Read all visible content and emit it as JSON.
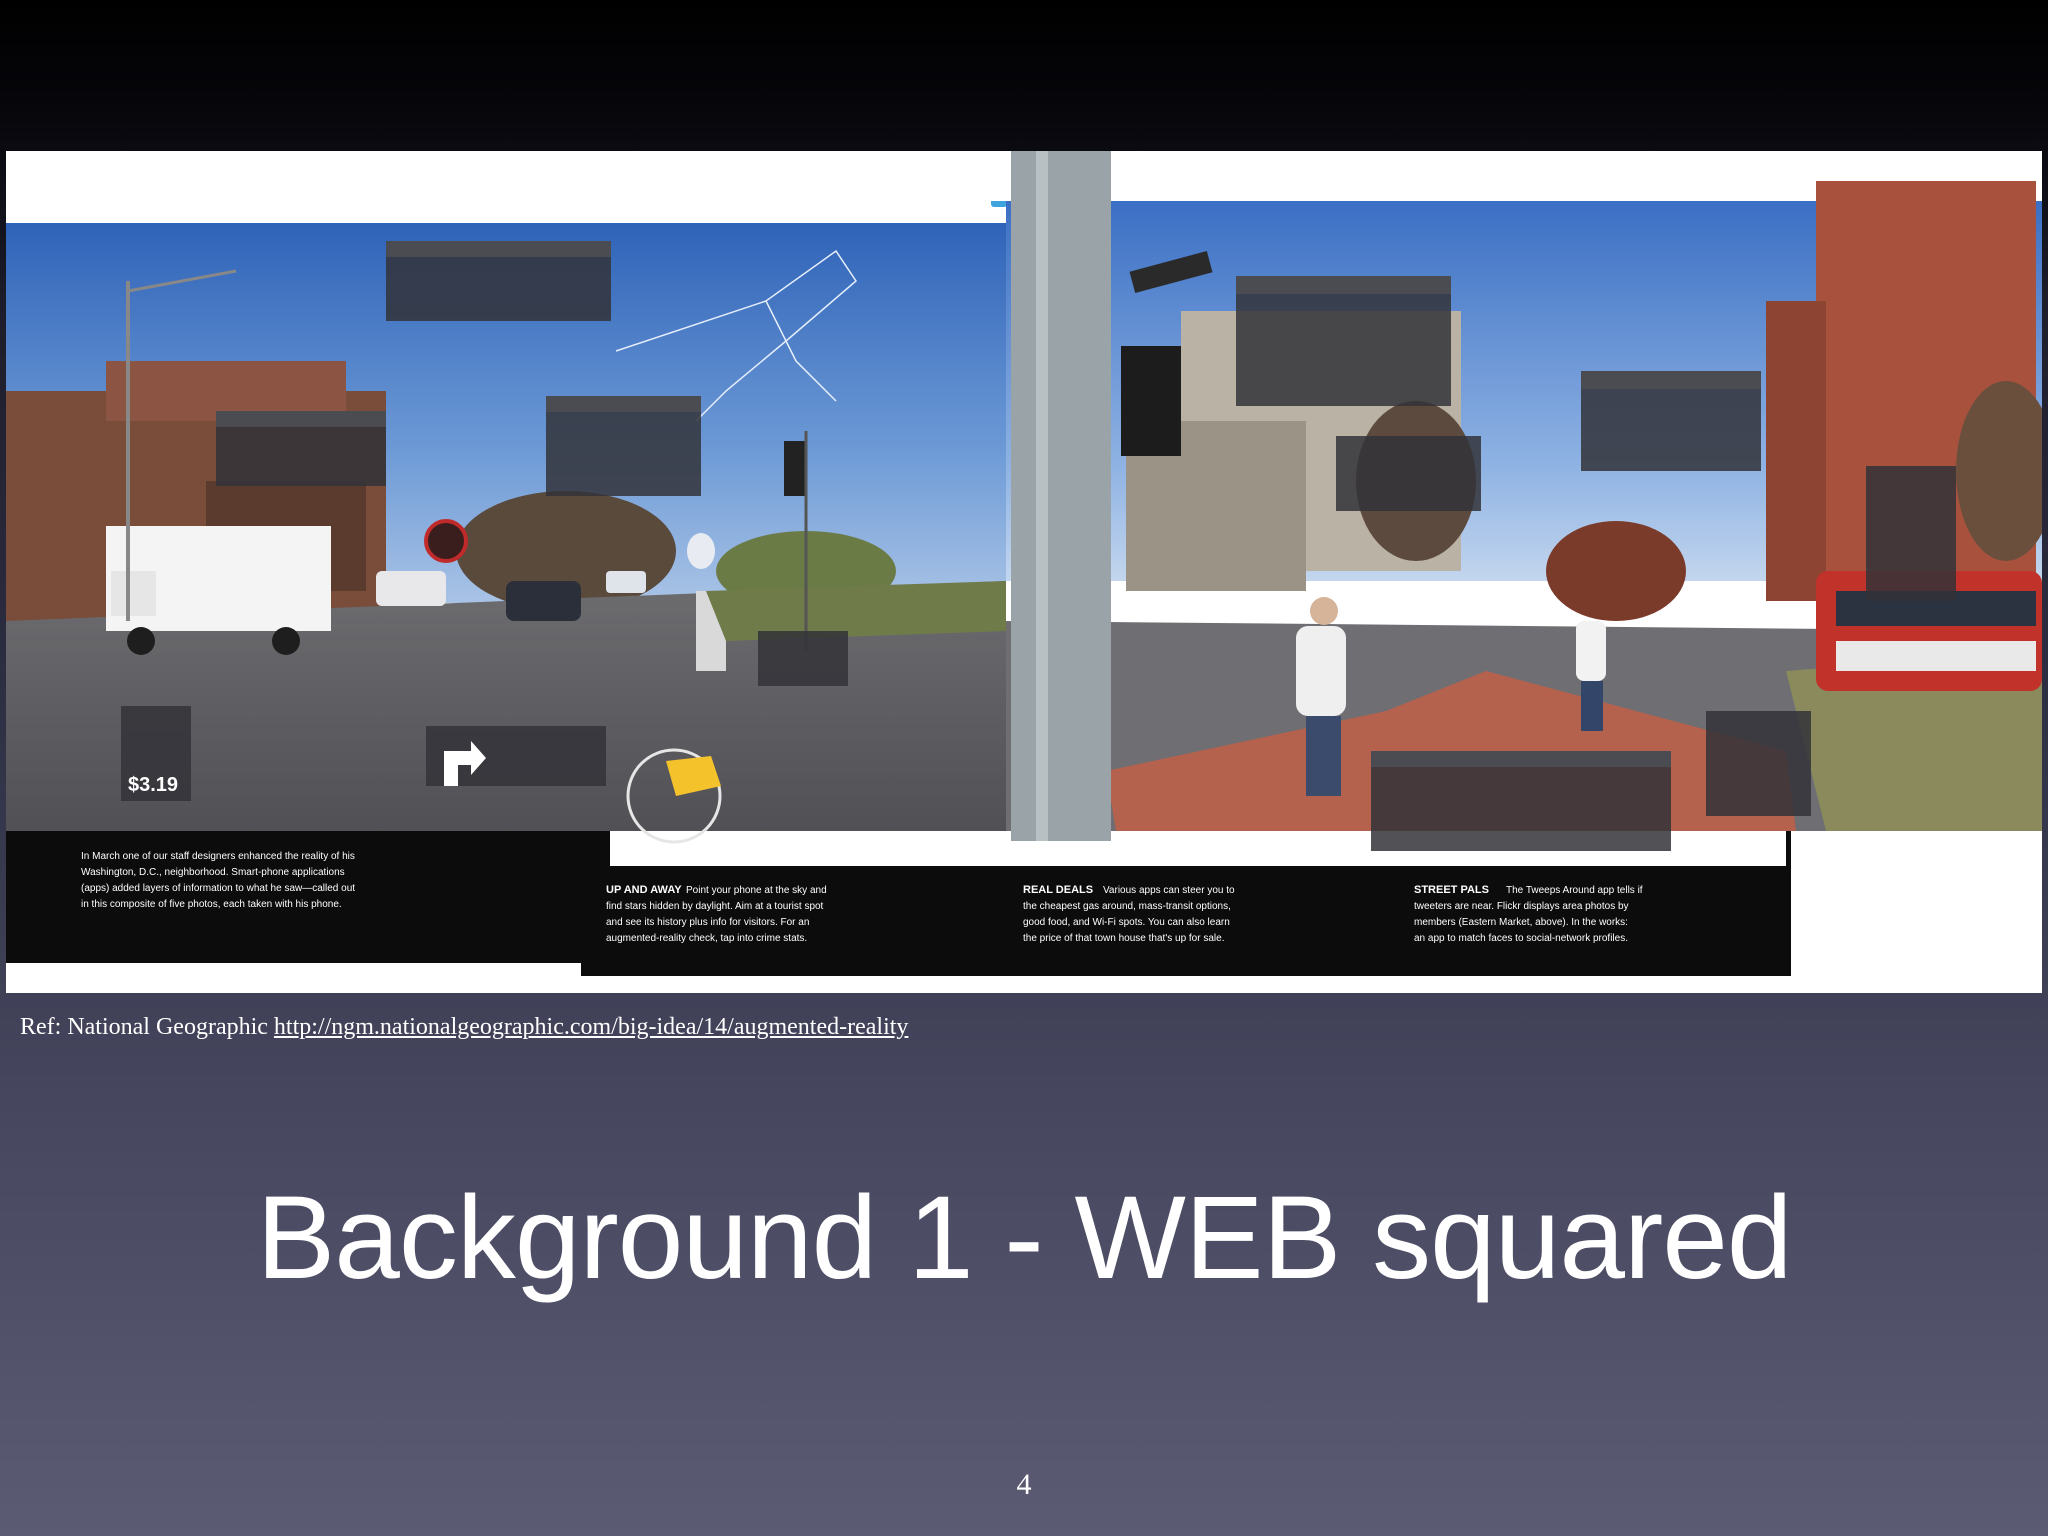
{
  "slide": {
    "title": "Background 1 - WEB squared",
    "page_number": "4"
  },
  "reference": {
    "prefix": "Ref: National Geographic ",
    "link_text": "http://ngm.nationalgeographic.com/big-idea/14/augmented-reality"
  },
  "figure": {
    "price_tag": "$3.19",
    "captions": {
      "intro": [
        "In March one of our staff designers enhanced the reality of his",
        "Washington, D.C., neighborhood. Smart-phone applications",
        "(apps) added layers of information to what he saw—called out",
        "in this composite of five photos, each taken with his phone."
      ],
      "up_and_away": {
        "heading": "UP AND AWAY",
        "lines": [
          "Point your phone at the sky and",
          "find stars hidden by daylight. Aim at a tourist spot",
          "and see its history plus info for visitors. For an",
          "augmented-reality check, tap into crime stats."
        ]
      },
      "real_deals": {
        "heading": "REAL DEALS",
        "lines": [
          "Various apps can steer you to",
          "the cheapest gas around, mass-transit options,",
          "good food, and Wi-Fi spots. You can also learn",
          "the price of that town house that's up for sale."
        ]
      },
      "street_pals": {
        "heading": "STREET PALS",
        "lines": [
          "The Tweeps Around app tells if",
          "tweeters are near. Flickr displays area photos by",
          "members (Eastern Market, above). In the works:",
          "an app to match faces to social-network profiles."
        ]
      }
    }
  }
}
